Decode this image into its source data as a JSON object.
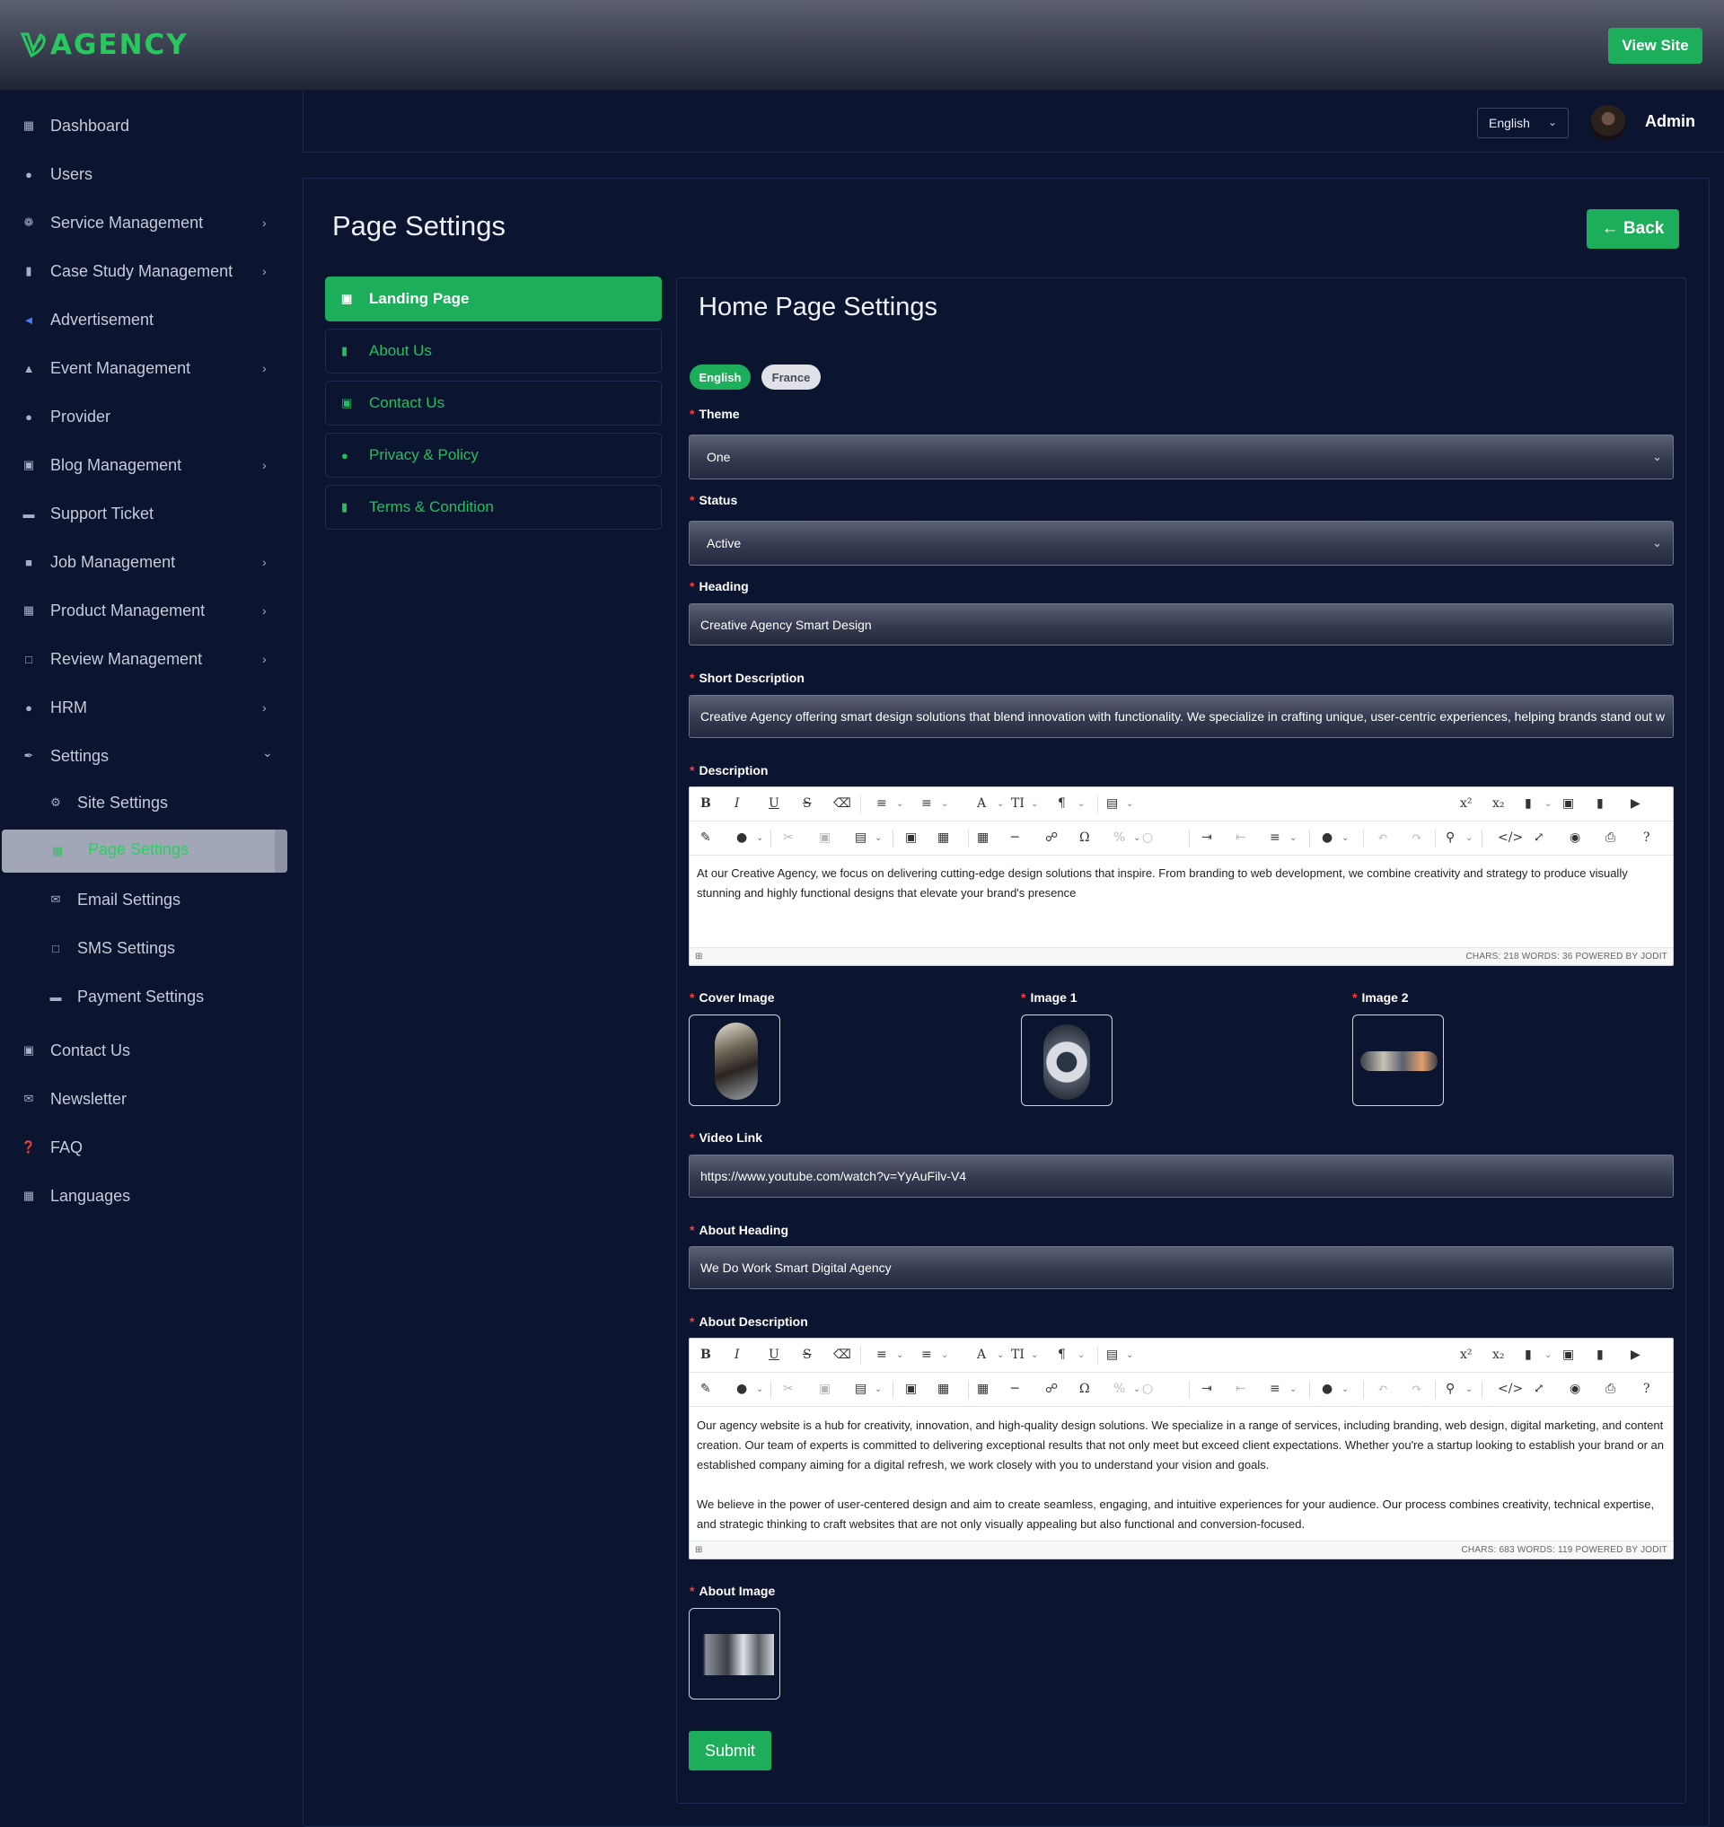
{
  "brand": {
    "name": "AGENCY",
    "color": "#27c95f"
  },
  "header": {
    "view_site_label": "View Site",
    "language": "English",
    "user_name": "Admin"
  },
  "sidebar": {
    "items": [
      {
        "label": "Dashboard",
        "icon": "dashboard-icon"
      },
      {
        "label": "Users",
        "icon": "users-icon"
      },
      {
        "label": "Service Management",
        "icon": "service-icon",
        "has_children": true
      },
      {
        "label": "Case Study Management",
        "icon": "document-icon",
        "has_children": true
      },
      {
        "label": "Advertisement",
        "icon": "megaphone-icon"
      },
      {
        "label": "Event Management",
        "icon": "trophy-icon",
        "has_children": true
      },
      {
        "label": "Provider",
        "icon": "user-tie-icon"
      },
      {
        "label": "Blog Management",
        "icon": "blog-icon",
        "has_children": true
      },
      {
        "label": "Support Ticket",
        "icon": "ticket-icon"
      },
      {
        "label": "Job Management",
        "icon": "briefcase-icon",
        "has_children": true
      },
      {
        "label": "Product Management",
        "icon": "grid-icon",
        "has_children": true
      },
      {
        "label": "Review Management",
        "icon": "comment-icon",
        "has_children": true
      },
      {
        "label": "HRM",
        "icon": "team-icon",
        "has_children": true
      },
      {
        "label": "Settings",
        "icon": "wrench-icon",
        "expanded": true
      }
    ],
    "settings_children": [
      {
        "label": "Site Settings",
        "icon": "gear-icon"
      },
      {
        "label": "Page Settings",
        "icon": "page-icon",
        "active": true
      },
      {
        "label": "Email Settings",
        "icon": "email-icon"
      },
      {
        "label": "SMS Settings",
        "icon": "sms-icon"
      },
      {
        "label": "Payment Settings",
        "icon": "card-icon"
      }
    ],
    "bottom_items": [
      {
        "label": "Contact Us",
        "icon": "contact-card-icon"
      },
      {
        "label": "Newsletter",
        "icon": "envelope-icon"
      },
      {
        "label": "FAQ",
        "icon": "question-icon"
      },
      {
        "label": "Languages",
        "icon": "language-icon"
      }
    ]
  },
  "page": {
    "title": "Page Settings",
    "back_label": "← Back"
  },
  "tabs": [
    {
      "label": "Landing Page",
      "icon": "image-card-icon",
      "active": true
    },
    {
      "label": "About Us",
      "icon": "file-icon"
    },
    {
      "label": "Contact Us",
      "icon": "id-card-icon"
    },
    {
      "label": "Privacy & Policy",
      "icon": "shield-icon"
    },
    {
      "label": "Terms & Condition",
      "icon": "file-icon"
    }
  ],
  "form": {
    "title": "Home Page Settings",
    "languages": [
      "English",
      "France"
    ],
    "theme": {
      "label": "Theme",
      "value": "One"
    },
    "status": {
      "label": "Status",
      "value": "Active"
    },
    "heading": {
      "label": "Heading",
      "value": "Creative Agency Smart Design"
    },
    "short_description": {
      "label": "Short Description",
      "value": "Creative Agency offering smart design solutions that blend innovation with functionality. We specialize in crafting unique, user-centric experiences, helping brands stand out w"
    },
    "description": {
      "label": "Description",
      "content": "At our Creative Agency, we focus on delivering cutting-edge design solutions that inspire. From branding to web development, we combine creativity and strategy to produce visually stunning and highly functional designs that elevate your brand's presence",
      "stats": "CHARS: 218   WORDS: 36   POWERED BY JODIT"
    },
    "cover_image": {
      "label": "Cover Image"
    },
    "image1": {
      "label": "Image 1"
    },
    "image2": {
      "label": "Image 2"
    },
    "video_link": {
      "label": "Video Link",
      "value": "https://www.youtube.com/watch?v=YyAuFilv-V4"
    },
    "about_heading": {
      "label": "About Heading",
      "value": "We Do Work Smart Digital Agency"
    },
    "about_description": {
      "label": "About Description",
      "paragraph1": "Our agency website is a hub for creativity, innovation, and high-quality design solutions. We specialize in a range of services, including branding, web design, digital marketing, and content creation. Our team of experts is committed to delivering exceptional results that not only meet but exceed client expectations. Whether you're a startup looking to establish your brand or an established company aiming for a digital refresh, we work closely with you to understand your vision and goals.",
      "paragraph2": "We believe in the power of user-centered design and aim to create seamless, engaging, and intuitive experiences for your audience. Our process combines creativity, technical expertise, and strategic thinking to craft websites that are not only visually appealing but also functional and conversion-focused.",
      "stats": "CHARS: 683   WORDS: 119   POWERED BY JODIT"
    },
    "about_image": {
      "label": "About Image"
    },
    "submit_label": "Submit"
  },
  "editor_toolbar": {
    "row1": [
      "B",
      "I",
      "U",
      "S",
      "eraser",
      "ul",
      "ol",
      "A",
      "TI",
      "¶",
      "align-list",
      "x²",
      "x₂",
      "source",
      "image",
      "file",
      "video"
    ],
    "row2": [
      "brush",
      "mic",
      "cut",
      "copy",
      "paste",
      "select-all",
      "format-painter",
      "table",
      "hr",
      "link",
      "Ω",
      "percent",
      "clear",
      "indent",
      "outdent",
      "align",
      "color",
      "undo",
      "redo",
      "find",
      "code",
      "fullsize",
      "preview",
      "print",
      "?"
    ]
  }
}
